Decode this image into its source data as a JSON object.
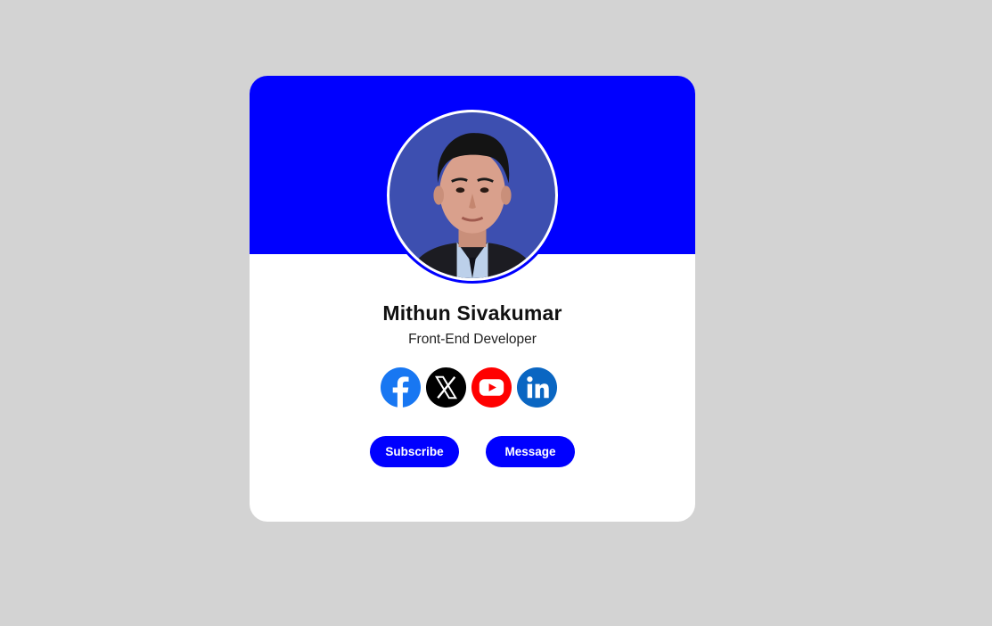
{
  "profile": {
    "name": "Mithun Sivakumar",
    "role": "Front-End Developer"
  },
  "social": [
    {
      "icon": "facebook-icon",
      "color": "#1877f2"
    },
    {
      "icon": "x-icon",
      "color": "#000000"
    },
    {
      "icon": "youtube-icon",
      "color": "#ff0000"
    },
    {
      "icon": "linkedin-icon",
      "color": "#0a66c2"
    }
  ],
  "actions": {
    "subscribe_label": "Subscribe",
    "message_label": "Message"
  },
  "colors": {
    "accent": "#0000ff",
    "background": "#d3d3d3",
    "card": "#ffffff"
  }
}
